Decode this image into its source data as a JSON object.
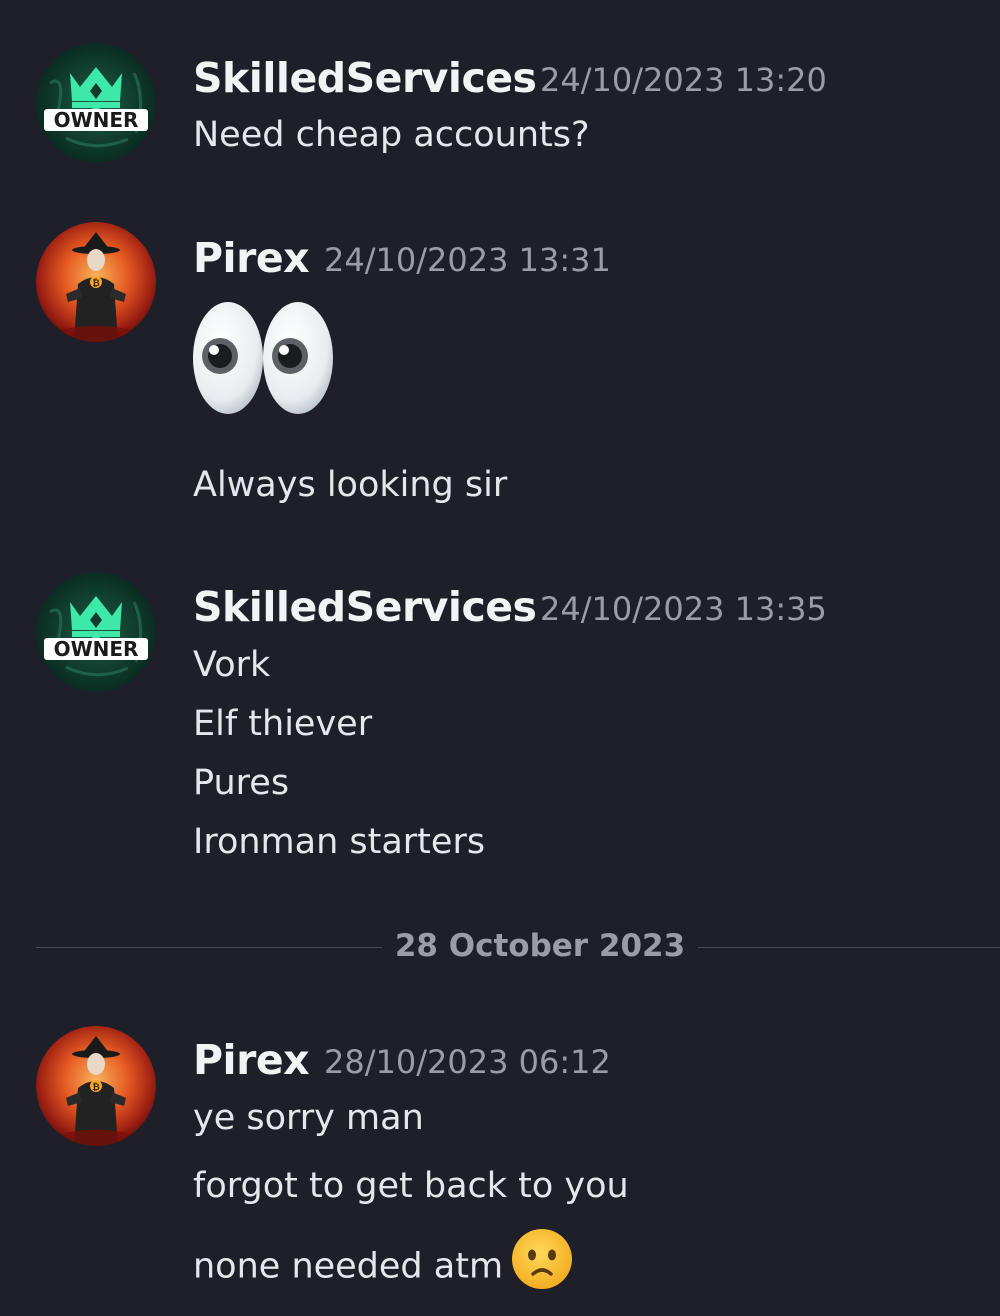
{
  "messages": [
    {
      "author": "SkilledServices",
      "timestamp": "24/10/2023 13:20",
      "avatar_badge": "OWNER",
      "lines": [
        "Need cheap accounts?"
      ]
    },
    {
      "author": "Pirex",
      "timestamp": "24/10/2023 13:31",
      "emoji": "eyes-emoji",
      "lines": [
        "Always looking sir"
      ]
    },
    {
      "author": "SkilledServices",
      "timestamp": "24/10/2023 13:35",
      "avatar_badge": "OWNER",
      "lines": [
        "Vork",
        "Elf thiever",
        "Pures",
        "Ironman starters"
      ]
    },
    {
      "author": "Pirex",
      "timestamp": "28/10/2023 06:12",
      "lines": [
        "ye sorry man",
        "forgot to get back to you",
        "none needed atm"
      ],
      "trailing_emoji": "frowning-face-emoji"
    }
  ],
  "date_divider": "28 October 2023",
  "colors": {
    "background": "#1e1f29",
    "username": "#f2f3f5",
    "timestamp": "#9a9ca6",
    "message_text": "#e6e7eb",
    "owner_avatar_green": "#3ee8a8"
  }
}
